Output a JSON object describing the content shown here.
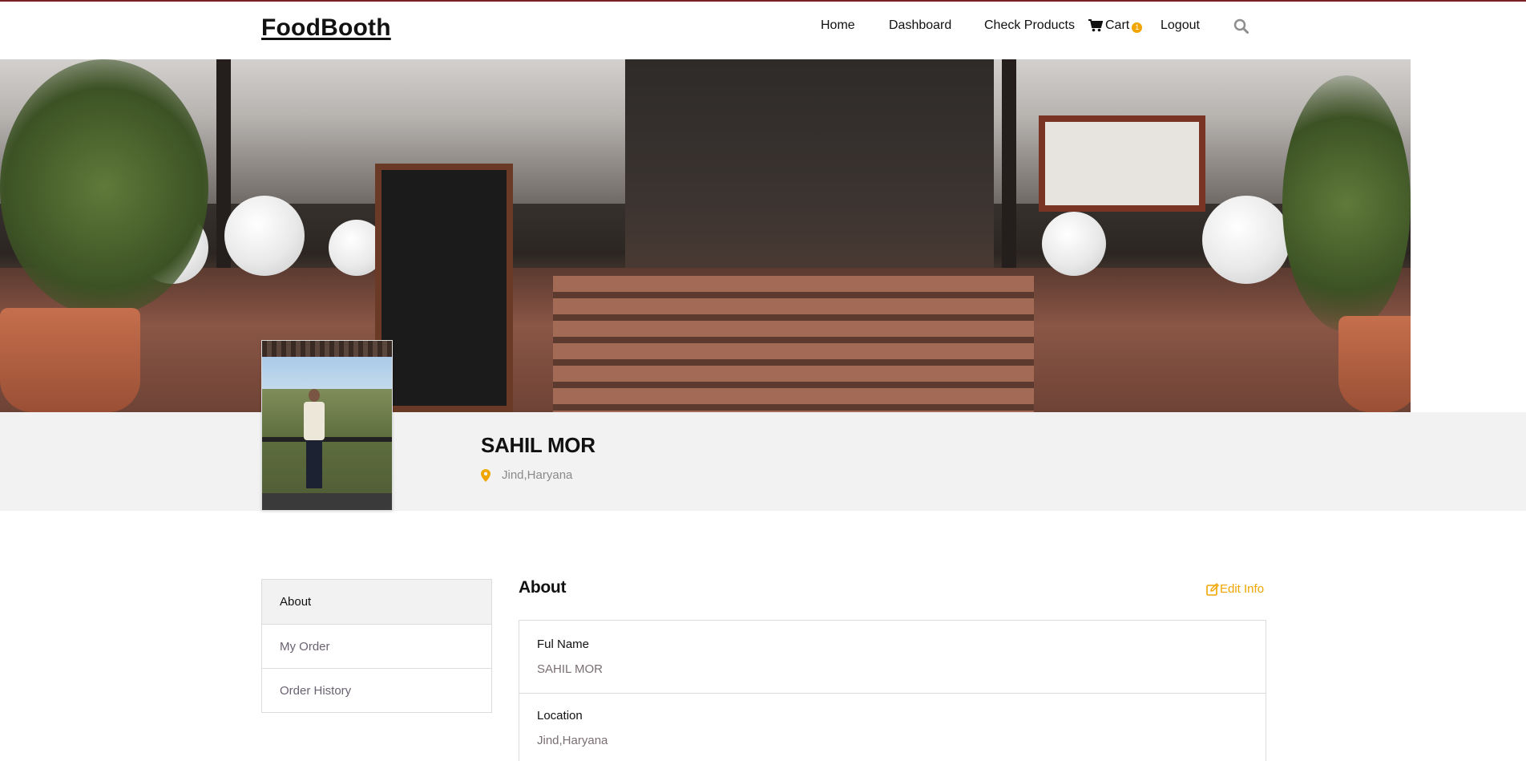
{
  "navbar": {
    "brand": "FoodBooth",
    "links": {
      "home": "Home",
      "dashboard": "Dashboard",
      "check_products": "Check Products",
      "cart": "Cart",
      "cart_count": "1",
      "logout": "Logout"
    },
    "icons": {
      "cart": "cart-icon",
      "search": "search-icon"
    }
  },
  "profile": {
    "name": "SAHIL MOR",
    "location": "Jind,Haryana"
  },
  "side_menu": {
    "items": [
      {
        "label": "About",
        "active": true
      },
      {
        "label": "My Order",
        "active": false
      },
      {
        "label": "Order History",
        "active": false
      }
    ]
  },
  "about": {
    "title": "About",
    "edit_label": "Edit Info",
    "fields": [
      {
        "label": "Ful Name",
        "value": "SAHIL MOR"
      },
      {
        "label": "Location",
        "value": "Jind,Haryana"
      }
    ]
  },
  "colors": {
    "accent": "#f0a500",
    "topline": "#7a1f24",
    "band": "#f2f2f2"
  }
}
